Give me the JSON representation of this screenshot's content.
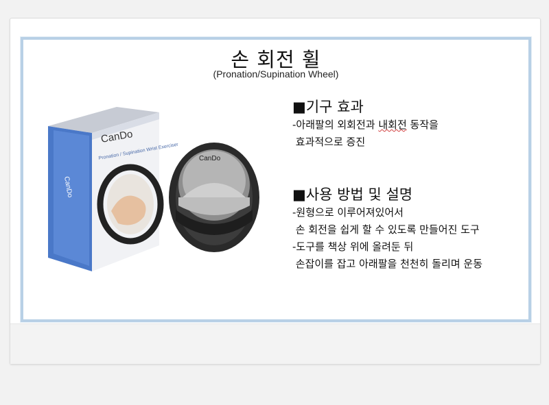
{
  "slide": {
    "title": "손 회전 휠",
    "subtitle": "(Pronation/Supination Wheel)"
  },
  "product": {
    "brand": "CanDo",
    "box_caption": "Pronation / Supination Wrist Exerciser"
  },
  "effects": {
    "heading": "■기구 효과",
    "line1_pre": "-아래팔의 외회전과 ",
    "line1_mark": "내회전",
    "line1_post": " 동작을",
    "line2": " 효과적으로 증진"
  },
  "usage": {
    "heading": "■사용 방법 및 설명",
    "lines": [
      "-원형으로 이루어져있어서",
      " 손 회전을 쉽게 할 수 있도록 만들어진 도구",
      "-도구를 책상 위에 올려둔 뒤",
      " 손잡이를 잡고 아래팔을 천천히 돌리며 운동"
    ]
  }
}
